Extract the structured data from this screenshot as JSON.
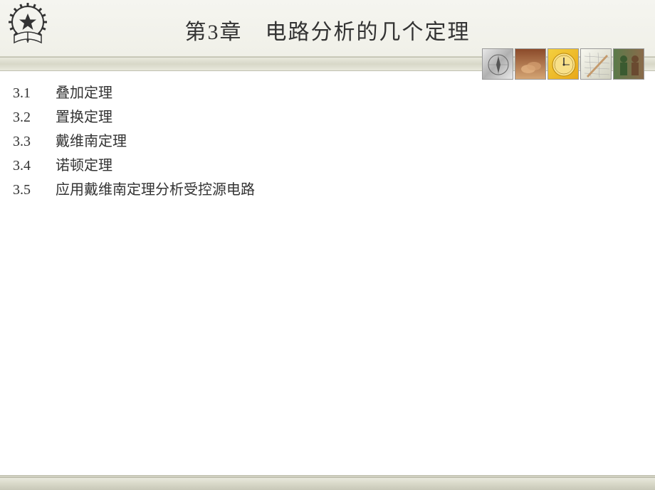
{
  "header": {
    "title": "第3章　电路分析的几个定理"
  },
  "toc": {
    "items": [
      {
        "number": "3.1",
        "title": "叠加定理"
      },
      {
        "number": "3.2",
        "title": "置换定理"
      },
      {
        "number": "3.3",
        "title": "戴维南定理"
      },
      {
        "number": "3.4",
        "title": "诺顿定理"
      },
      {
        "number": "3.5",
        "title": "应用戴维南定理分析受控源电路"
      }
    ]
  },
  "thumbnails": [
    {
      "name": "compass-thumb"
    },
    {
      "name": "hands-thumb"
    },
    {
      "name": "clock-thumb"
    },
    {
      "name": "drawing-thumb"
    },
    {
      "name": "people-thumb"
    }
  ]
}
